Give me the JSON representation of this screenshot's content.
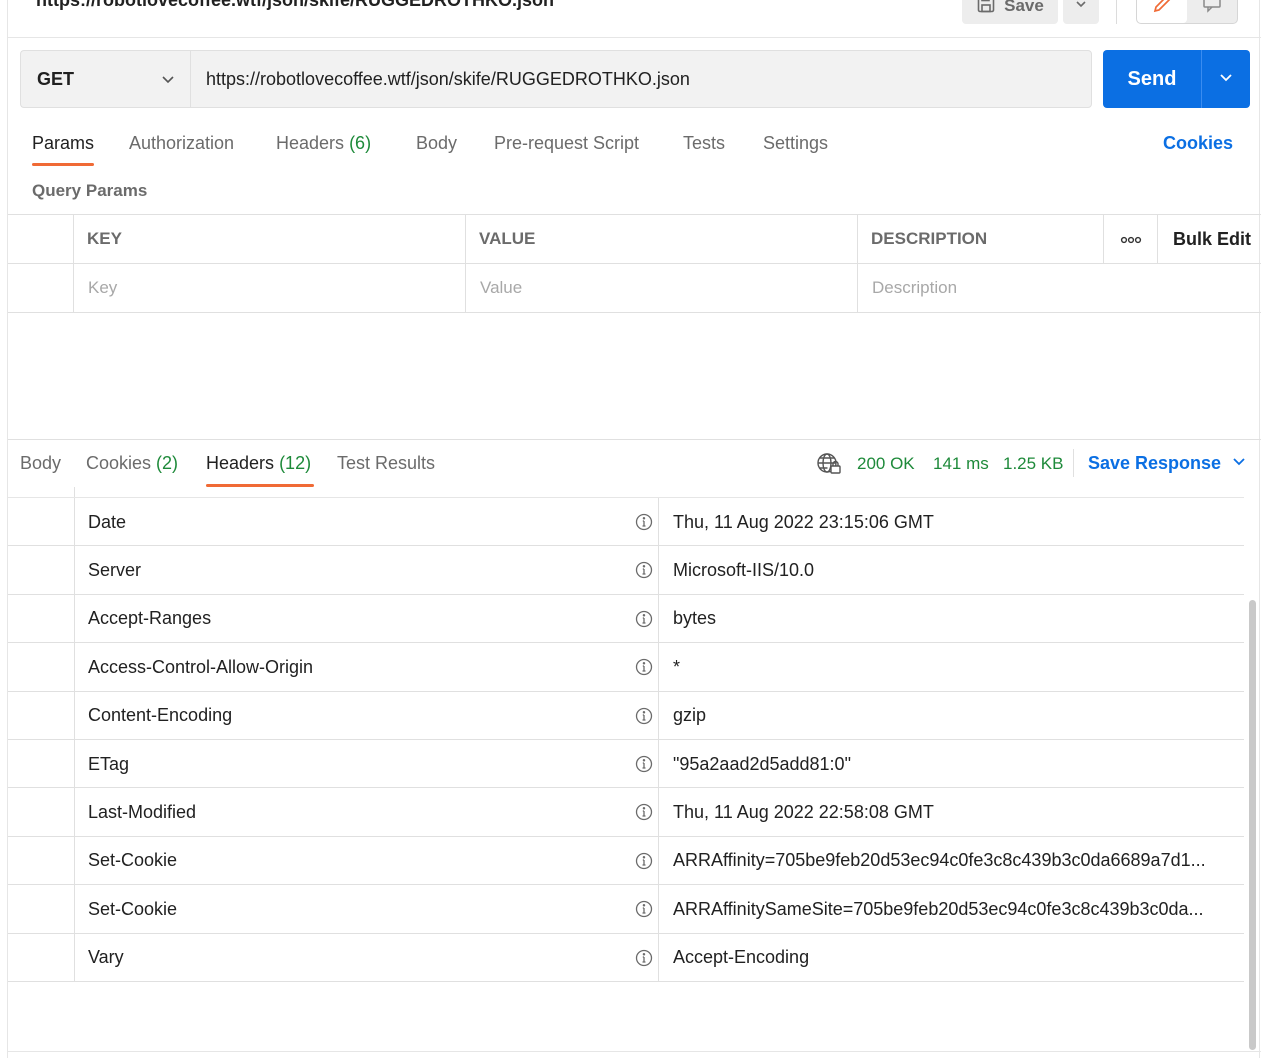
{
  "request": {
    "title": "https://robotlovecoffee.wtf/json/skife/RUGGEDROTHKO.json",
    "save_label": "Save",
    "method": "GET",
    "url": "https://robotlovecoffee.wtf/json/skife/RUGGEDROTHKO.json",
    "send_label": "Send"
  },
  "request_tabs": {
    "params": "Params",
    "authorization": "Authorization",
    "headers": "Headers",
    "headers_count": "(6)",
    "body": "Body",
    "pre_request": "Pre-request Script",
    "tests": "Tests",
    "settings": "Settings",
    "cookies": "Cookies"
  },
  "query_params": {
    "section_label": "Query Params",
    "columns": {
      "key": "KEY",
      "value": "VALUE",
      "description": "DESCRIPTION",
      "bulk_edit": "Bulk Edit"
    },
    "placeholders": {
      "key": "Key",
      "value": "Value",
      "description": "Description"
    }
  },
  "response": {
    "tabs": {
      "body": "Body",
      "cookies": "Cookies",
      "cookies_count": "(2)",
      "headers": "Headers",
      "headers_count": "(12)",
      "test_results": "Test Results"
    },
    "status": "200 OK",
    "time": "141 ms",
    "size": "1.25 KB",
    "save_response": "Save Response",
    "headers": [
      {
        "key": "Date",
        "value": "Thu, 11 Aug 2022 23:15:06 GMT"
      },
      {
        "key": "Server",
        "value": "Microsoft-IIS/10.0"
      },
      {
        "key": "Accept-Ranges",
        "value": "bytes"
      },
      {
        "key": "Access-Control-Allow-Origin",
        "value": "*"
      },
      {
        "key": "Content-Encoding",
        "value": "gzip"
      },
      {
        "key": "ETag",
        "value": "\"95a2aad2d5add81:0\""
      },
      {
        "key": "Last-Modified",
        "value": "Thu, 11 Aug 2022 22:58:08 GMT"
      },
      {
        "key": "Set-Cookie",
        "value": "ARRAffinity=705be9feb20d53ec94c0fe3c8c439b3c0da6689a7d1..."
      },
      {
        "key": "Set-Cookie",
        "value": "ARRAffinitySameSite=705be9feb20d53ec94c0fe3c8c439b3c0da..."
      },
      {
        "key": "Vary",
        "value": "Accept-Encoding"
      }
    ]
  },
  "colors": {
    "accent_blue": "#0b6fe3",
    "tab_underline": "#f06a35",
    "status_green": "#1e8a3a"
  },
  "icons": [
    "save-icon",
    "chevron-down-icon",
    "edit-pencil-icon",
    "comment-icon",
    "more-options-icon",
    "info-icon",
    "globe-lock-icon"
  ]
}
